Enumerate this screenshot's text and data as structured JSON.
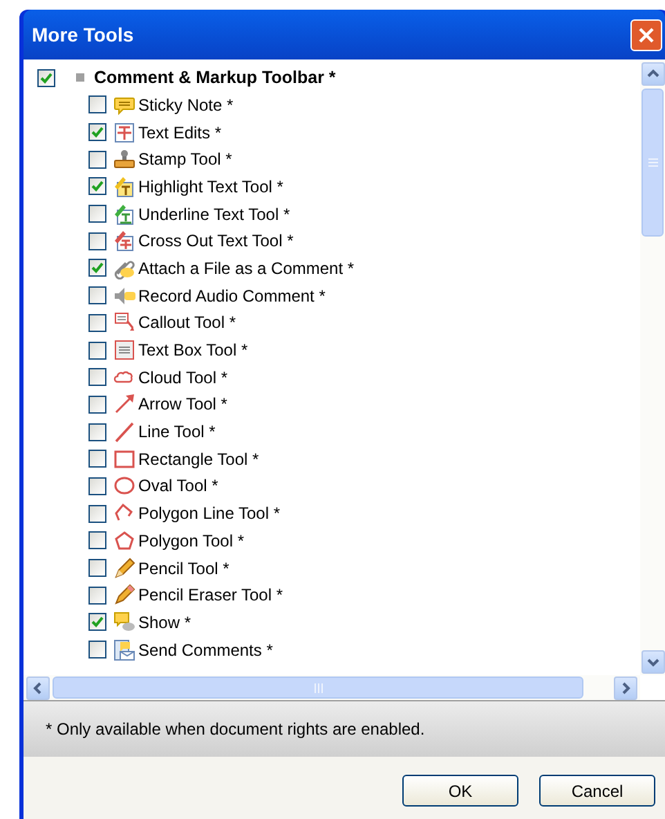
{
  "window": {
    "title": "More Tools"
  },
  "toolbar": {
    "label": "Comment & Markup Toolbar *",
    "checked": true,
    "children": [
      {
        "label": "Sticky Note *",
        "checked": false
      },
      {
        "label": "Text Edits *",
        "checked": true
      },
      {
        "label": "Stamp Tool *",
        "checked": false
      },
      {
        "label": "Highlight Text Tool *",
        "checked": true
      },
      {
        "label": "Underline Text Tool *",
        "checked": false
      },
      {
        "label": "Cross Out Text Tool *",
        "checked": false
      },
      {
        "label": "Attach a File as a Comment *",
        "checked": true
      },
      {
        "label": "Record Audio Comment *",
        "checked": false
      },
      {
        "label": "Callout Tool *",
        "checked": false
      },
      {
        "label": "Text Box Tool *",
        "checked": false
      },
      {
        "label": "Cloud Tool *",
        "checked": false
      },
      {
        "label": "Arrow Tool *",
        "checked": false
      },
      {
        "label": "Line Tool *",
        "checked": false
      },
      {
        "label": "Rectangle Tool *",
        "checked": false
      },
      {
        "label": "Oval Tool *",
        "checked": false
      },
      {
        "label": "Polygon Line Tool *",
        "checked": false
      },
      {
        "label": "Polygon Tool *",
        "checked": false
      },
      {
        "label": "Pencil Tool *",
        "checked": false
      },
      {
        "label": "Pencil Eraser Tool *",
        "checked": false
      },
      {
        "label": "Show *",
        "checked": true
      },
      {
        "label": "Send Comments *",
        "checked": false
      }
    ]
  },
  "footnote": "* Only available when document rights are enabled.",
  "buttons": [
    "OK",
    "Cancel"
  ]
}
